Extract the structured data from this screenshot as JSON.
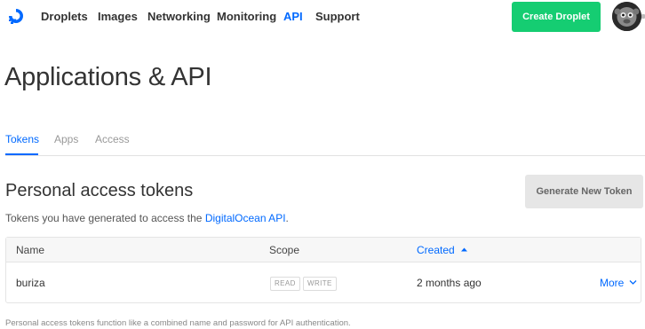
{
  "nav": {
    "items": [
      {
        "label": "Droplets",
        "active": false
      },
      {
        "label": "Images",
        "active": false
      },
      {
        "label": "Networking",
        "active": false
      },
      {
        "label": "Monitoring",
        "active": false
      },
      {
        "label": "API",
        "active": true
      },
      {
        "label": "Support",
        "active": false
      }
    ],
    "create_label": "Create Droplet",
    "logo_icon": "digitalocean-logo-icon",
    "brand_color": "#0069ff",
    "create_color": "#15cd72"
  },
  "page": {
    "title": "Applications & API"
  },
  "tabs": [
    {
      "label": "Tokens",
      "active": true
    },
    {
      "label": "Apps",
      "active": false
    },
    {
      "label": "Access",
      "active": false
    }
  ],
  "tokens": {
    "title": "Personal access tokens",
    "generate_label": "Generate New Token",
    "desc_prefix": "Tokens you have generated to access the ",
    "desc_link": "DigitalOcean API",
    "desc_suffix": ".",
    "columns": {
      "name": "Name",
      "scope": "Scope",
      "created": "Created",
      "sort_icon": "sort-up-icon"
    },
    "rows": [
      {
        "name": "buriza",
        "scopes": [
          "READ",
          "WRITE"
        ],
        "created": "2 months ago",
        "more_label": "More"
      }
    ],
    "footnote": "Personal access tokens function like a combined name and password for API authentication."
  }
}
